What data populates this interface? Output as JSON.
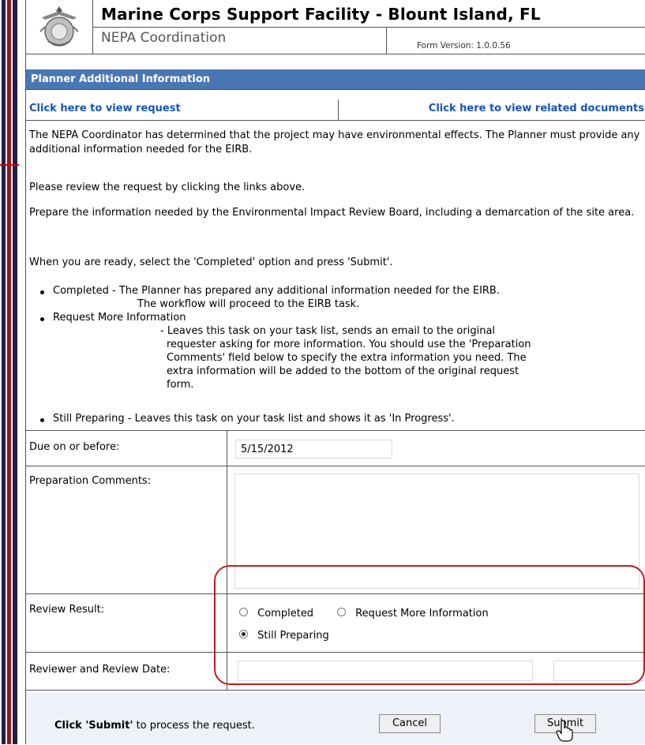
{
  "header": {
    "title": "Marine Corps Support Facility - Blount Island, FL",
    "subtitle": "NEPA Coordination",
    "version_label": "Form Version:",
    "version_value": "1.0.0.56"
  },
  "section_title": "Planner Additional Information",
  "links": {
    "view_request": "Click here to view request",
    "view_documents": "Click here to view related documents"
  },
  "instructions": {
    "para1": "The NEPA Coordinator has determined that the project may have environmental effects. The Planner must provide any additional information needed for the EIRB.",
    "para2": "Please review the request by clicking the links above.",
    "para3": "Prepare the information needed by the Environmental Impact Review Board, including a demarcation of the site area.",
    "para4": "When you are ready, select the 'Completed' option and press 'Submit'."
  },
  "options": {
    "completed_line1": "Completed - The Planner has prepared any additional information needed for the EIRB.",
    "completed_line2": "The workflow will proceed to the EIRB task.",
    "more_info_title": "Request More Information",
    "more_info_l1": "- Leaves this task on your task list, sends an email to the original",
    "more_info_l2": "requester asking for more information. You should use the 'Preparation",
    "more_info_l3": "Comments' field below to specify the extra information you need. The",
    "more_info_l4": "extra information will be added to the bottom of the original request",
    "more_info_l5": "form.",
    "still_preparing": "Still Preparing - Leaves this task on your task list and shows it as 'In Progress'."
  },
  "form": {
    "due_label": "Due on or before:",
    "due_value": "5/15/2012",
    "comments_label": "Preparation Comments:",
    "comments_value": "",
    "result_label": "Review Result:",
    "result_options": {
      "completed": "Completed",
      "request_more": "Request More Information",
      "still_preparing": "Still Preparing"
    },
    "selected_result": "Still Preparing",
    "reviewer_label": "Reviewer and Review Date:",
    "reviewer_value": "",
    "date_value": ""
  },
  "footer": {
    "submit_hint_bold": "Click 'Submit'",
    "submit_hint_rest": " to process the request.",
    "cancel_label": "Cancel",
    "submit_label": "Submit"
  },
  "colors": {
    "section_bar": "#4a77b4",
    "link": "#1554b8",
    "highlight_outline": "#c01d1d"
  },
  "icons": {
    "logo": "usmc-emblem-icon",
    "cursor": "hand-pointer-icon"
  }
}
